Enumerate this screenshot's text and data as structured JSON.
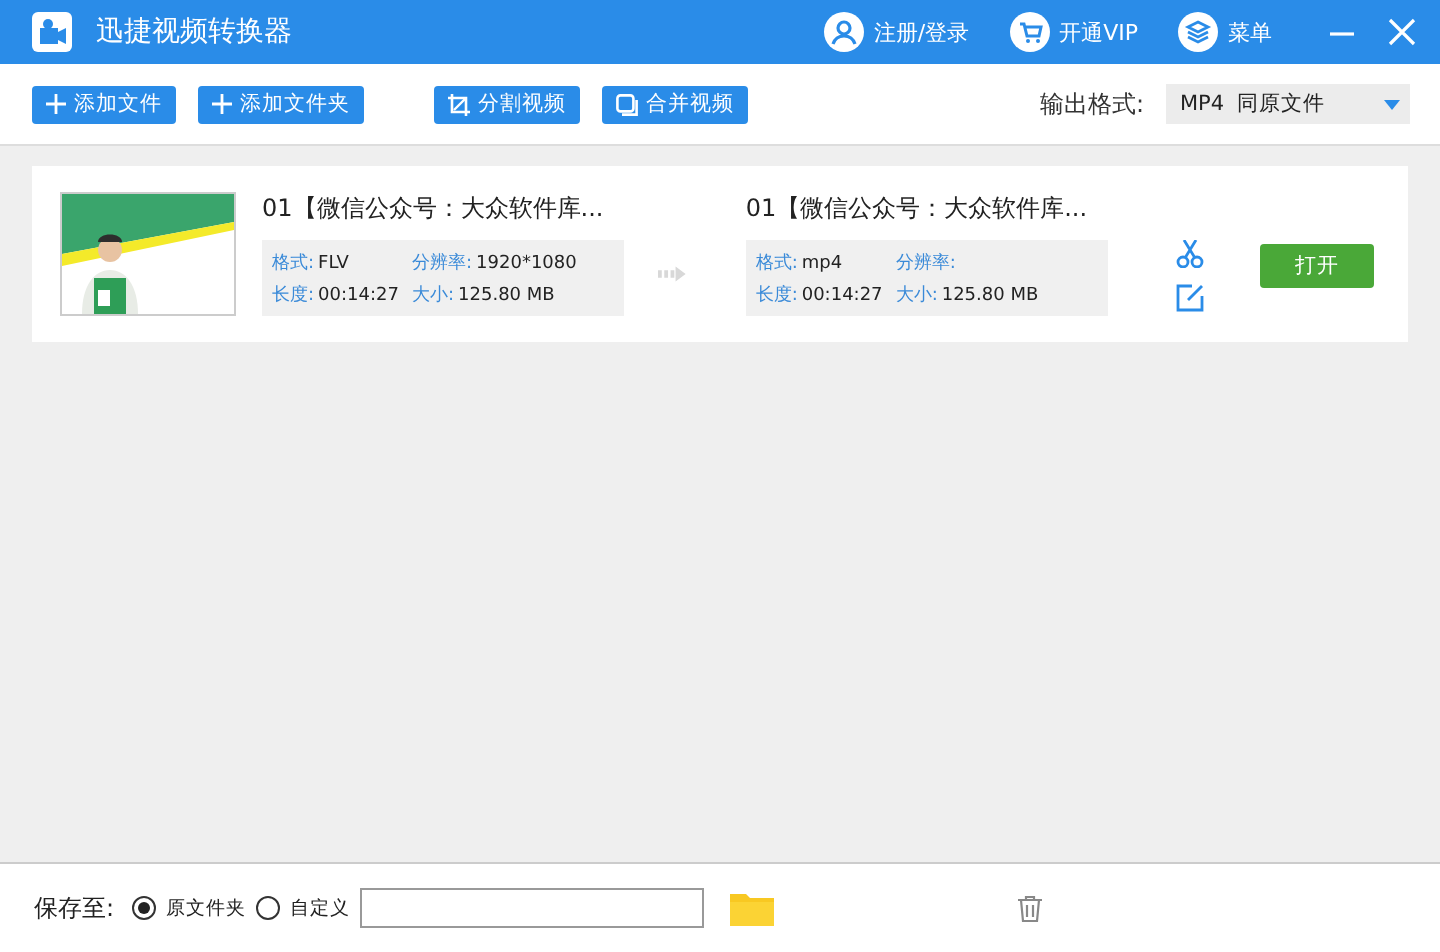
{
  "window": {
    "title": "迅捷视频转换器",
    "actions": [
      {
        "kind": "user",
        "label": "注册/登录"
      },
      {
        "kind": "cart",
        "label": "开通VIP"
      },
      {
        "kind": "layers",
        "label": "菜单"
      }
    ]
  },
  "toolbar": {
    "buttons": [
      {
        "kind": "plus",
        "label": "添加文件"
      },
      {
        "kind": "plus",
        "label": "添加文件夹"
      },
      {
        "kind": "crop",
        "label": "分割视频"
      },
      {
        "kind": "merge",
        "label": "合并视频"
      }
    ],
    "output_format": {
      "label": "输出格式:",
      "value": "MP4  同原文件"
    }
  },
  "files": [
    {
      "source": {
        "name": "01【微信公众号：大众软件库...",
        "fields": [
          {
            "label": "格式:",
            "value": "FLV"
          },
          {
            "label": "分辨率:",
            "value": "1920*1080"
          },
          {
            "label": "长度:",
            "value": "00:14:27"
          },
          {
            "label": "大小:",
            "value": "125.80 MB"
          }
        ]
      },
      "target": {
        "name": "01【微信公众号：大众软件库...",
        "fields": [
          {
            "label": "格式:",
            "value": "mp4"
          },
          {
            "label": "分辨率:"
          },
          {
            "label": "长度:",
            "value": "00:14:27"
          },
          {
            "label": "大小:",
            "value": "125.80 MB"
          }
        ]
      },
      "action": "打开"
    }
  ],
  "save": {
    "label": "保存至:",
    "options": [
      {
        "label": "原文件夹",
        "selected": true
      },
      {
        "label": "自定义",
        "selected": false
      }
    ]
  }
}
